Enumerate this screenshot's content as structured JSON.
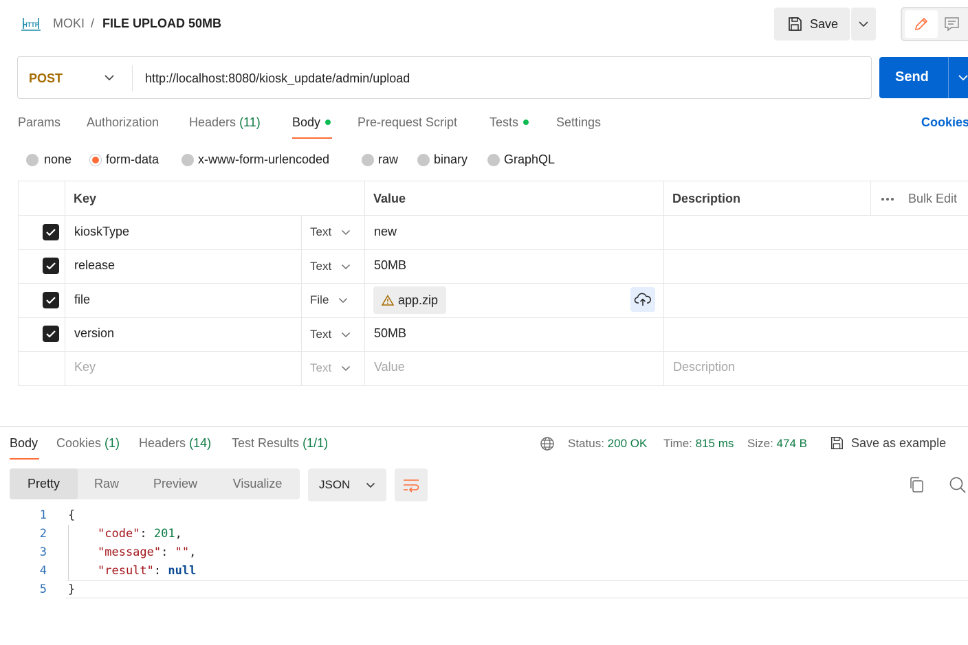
{
  "header": {
    "protocol_badge": "HTTP",
    "collection": "MOKI",
    "separator": "/",
    "request_name": "FILE UPLOAD 50MB",
    "save_label": "Save"
  },
  "request": {
    "method": "POST",
    "url": "http://localhost:8080/kiosk_update/admin/upload",
    "send_label": "Send"
  },
  "request_tabs": [
    {
      "label": "Params",
      "count": ""
    },
    {
      "label": "Authorization",
      "count": ""
    },
    {
      "label": "Headers",
      "count": "(11)"
    },
    {
      "label": "Body",
      "count": "",
      "active": true,
      "dot": true
    },
    {
      "label": "Pre-request Script",
      "count": ""
    },
    {
      "label": "Tests",
      "count": "",
      "dot": true
    },
    {
      "label": "Settings",
      "count": ""
    }
  ],
  "cookies_link": "Cookies",
  "body_types": [
    {
      "label": "none",
      "checked": false
    },
    {
      "label": "form-data",
      "checked": true
    },
    {
      "label": "x-www-form-urlencoded",
      "checked": false
    },
    {
      "label": "raw",
      "checked": false
    },
    {
      "label": "binary",
      "checked": false
    },
    {
      "label": "GraphQL",
      "checked": false
    }
  ],
  "form_table": {
    "headers": {
      "key": "Key",
      "value": "Value",
      "description": "Description",
      "bulk_edit": "Bulk Edit"
    },
    "rows": [
      {
        "checked": true,
        "key": "kioskType",
        "type": "Text",
        "value": "new"
      },
      {
        "checked": true,
        "key": "release",
        "type": "Text",
        "value": "50MB"
      },
      {
        "checked": true,
        "key": "file",
        "type": "File",
        "value": "app.zip"
      },
      {
        "checked": true,
        "key": "version",
        "type": "Text",
        "value": "50MB"
      }
    ],
    "placeholder": {
      "key": "Key",
      "type": "Text",
      "value": "Value",
      "description": "Description"
    }
  },
  "response": {
    "tabs": [
      {
        "label": "Body",
        "count": "",
        "active": true
      },
      {
        "label": "Cookies",
        "count": "(1)"
      },
      {
        "label": "Headers",
        "count": "(14)"
      },
      {
        "label": "Test Results",
        "count": "(1/1)"
      }
    ],
    "status_label": "Status:",
    "status_value": "200 OK",
    "time_label": "Time:",
    "time_value": "815 ms",
    "size_label": "Size:",
    "size_value": "474 B",
    "save_example": "Save as example",
    "views": [
      "Pretty",
      "Raw",
      "Preview",
      "Visualize"
    ],
    "active_view": "Pretty",
    "format": "JSON",
    "code": {
      "line_numbers": [
        "1",
        "2",
        "3",
        "4",
        "5"
      ],
      "open_brace": "{",
      "close_brace": "}",
      "code_key": "\"code\"",
      "code_value": "201",
      "message_key": "\"message\"",
      "message_value": "\"\"",
      "result_key": "\"result\"",
      "result_value": "null",
      "colon": ": ",
      "comma": ","
    }
  },
  "colors": {
    "accent_orange": "#ff6c37",
    "send_blue": "#0265d2",
    "method_post": "#a56b00",
    "count_green": "#0c7a43"
  }
}
